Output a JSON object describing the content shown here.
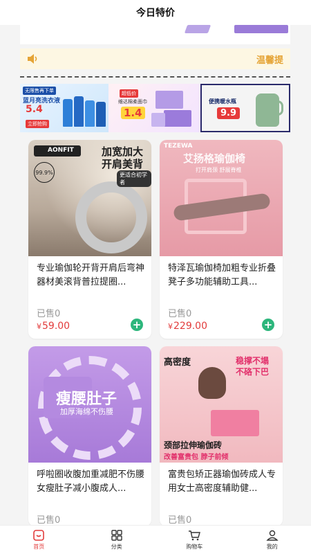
{
  "header": {
    "title": "今日特价"
  },
  "notice": {
    "text": "温馨提"
  },
  "promos": [
    {
      "tag": "无限售再下单",
      "heading": "蓝月亮洗衣液",
      "price": "5.4",
      "button": "立即抢购"
    },
    {
      "tag": "超低价",
      "heading": "维达棉柔面巾",
      "price": "1.4"
    },
    {
      "heading": "便携暖水瓶",
      "price": "9.9"
    }
  ],
  "products": [
    {
      "brand": "AONFIT",
      "img_line1": "加宽加大",
      "img_line2": "开肩美背",
      "img_sub": "更适合初学者",
      "img_badge": "99.9%",
      "title": "专业瑜伽轮开背开肩后弯神器材美滚背普拉提圈...",
      "sold": "已售0",
      "currency": "¥",
      "price": "59.00"
    },
    {
      "brand": "TEZEWA",
      "img_line1": "艾扬格瑜伽椅",
      "img_sub": "打开肩颈 舒展脊椎",
      "title": "特泽瓦瑜伽椅加粗专业折叠凳子多功能辅助工具...",
      "sold": "已售0",
      "currency": "¥",
      "price": "229.00"
    },
    {
      "img_line1": "瘦腰肚子",
      "img_sub": "加厚海绵不伤腰",
      "title": "呼啦圈收腹加重减肥不伤腰女瘦肚子减小腹成人...",
      "sold": "已售0"
    },
    {
      "img_line1": "高密度",
      "img_line2": "稳撑不塌",
      "img_line3": "不硌下巴",
      "img_line4": "颈部拉伸瑜伽砖",
      "img_line5": "改善富贵包 脖子前倾",
      "title": "富贵包矫正器瑜伽砖成人专用女士高密度辅助健...",
      "sold": "已售0"
    }
  ],
  "tabbar": [
    {
      "label": "首页"
    },
    {
      "label": "分类"
    },
    {
      "label": "购物车"
    },
    {
      "label": "我的"
    }
  ],
  "colors": {
    "accent": "#e23b3b",
    "add": "#2db67c",
    "notice": "#e5a436"
  }
}
